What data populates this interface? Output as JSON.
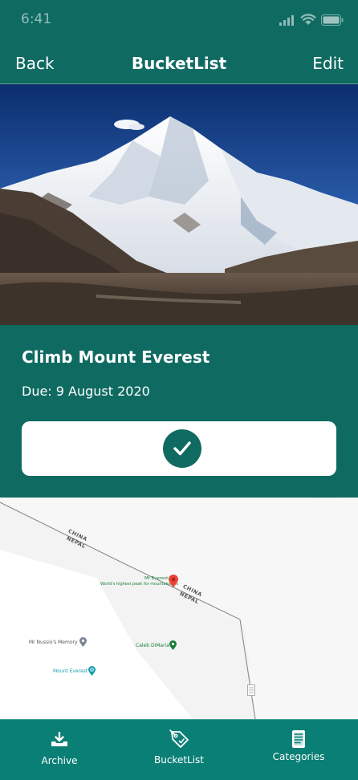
{
  "status_bar": {
    "time": "6:41",
    "icons": [
      "signal-icon",
      "wifi-icon",
      "battery-icon"
    ]
  },
  "nav": {
    "back_label": "Back",
    "title": "BucketList",
    "edit_label": "Edit"
  },
  "goal": {
    "title": "Climb Mount Everest",
    "due": "Due: 9 August 2020",
    "completed": true
  },
  "map": {
    "border_labels": [
      "CHINA",
      "NEPAL",
      "CHINA",
      "NEPAL"
    ],
    "places": [
      {
        "name": "Mt Everest",
        "subtitle": "World's highest peak for mountaineers",
        "icon": "map-pin-icon"
      },
      {
        "name": "Mr Nussio's Memory",
        "icon": "location-pin-icon"
      },
      {
        "name": "Caleb DiMaria",
        "icon": "location-pin-icon"
      },
      {
        "name": "Mount Everest",
        "icon": "camera-pin-icon"
      }
    ]
  },
  "tabs": [
    {
      "label": "Archive",
      "icon": "archive-download-icon"
    },
    {
      "label": "BucketList",
      "icon": "tag-icon"
    },
    {
      "label": "Categories",
      "icon": "list-document-icon"
    }
  ],
  "colors": {
    "primary": "#0f6b62",
    "tab_bar": "#0a7f76",
    "map_pin": "#ea4335"
  }
}
